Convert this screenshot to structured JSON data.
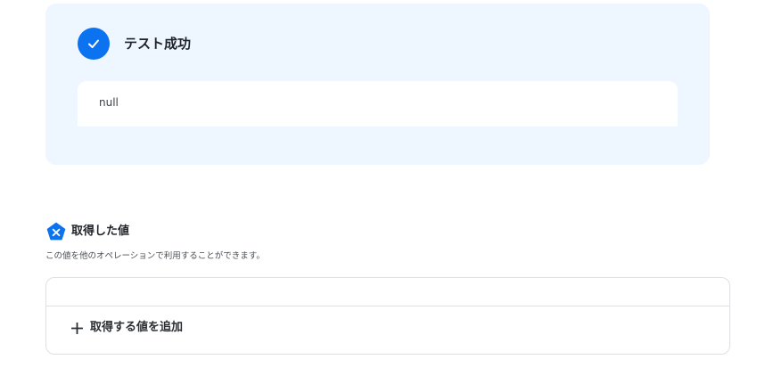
{
  "test_result": {
    "title": "テスト成功",
    "output": "null",
    "icon": "check-icon",
    "accent_color": "#0b72f0",
    "panel_color": "#eef6ff"
  },
  "acquired_values": {
    "title": "取得した値",
    "description": "この値を他のオペレーションで利用することができます。",
    "icon": "variable-badge-icon",
    "add_button_label": "取得する値を追加",
    "add_icon": "plus-icon"
  }
}
